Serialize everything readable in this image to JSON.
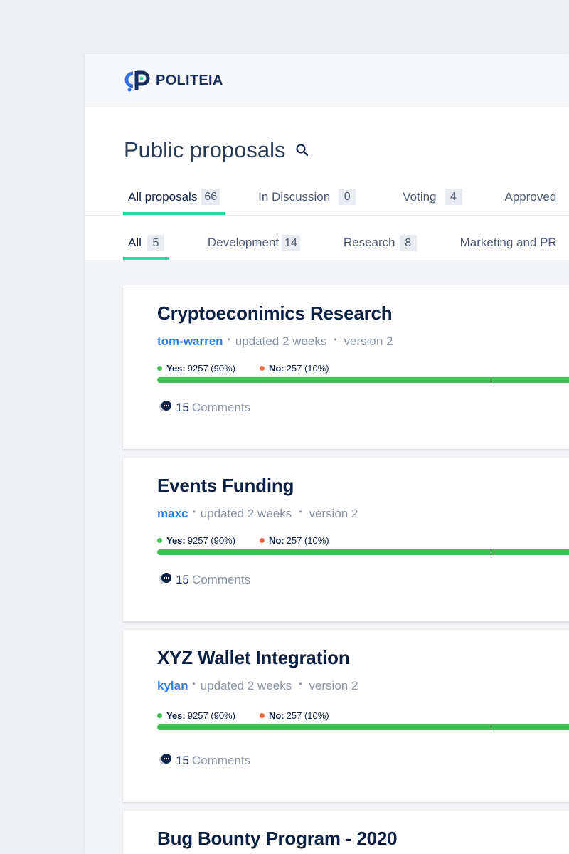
{
  "app": {
    "logo_text": "POLITEIA"
  },
  "page": {
    "title": "Public proposals"
  },
  "tabs": [
    {
      "label": "All proposals",
      "count": "66"
    },
    {
      "label": "In Discussion",
      "count": "0"
    },
    {
      "label": "Voting",
      "count": "4"
    },
    {
      "label": "Approved",
      "count": ""
    }
  ],
  "subtabs": [
    {
      "label": "All",
      "count": "5"
    },
    {
      "label": "Development",
      "count": "14"
    },
    {
      "label": "Research",
      "count": "8"
    },
    {
      "label": "Marketing and PR",
      "count": ""
    }
  ],
  "proposals": [
    {
      "title": "Cryptoeconimics Research",
      "author": "tom-warren",
      "updated": "updated 2 weeks",
      "version": "version 2",
      "yes_label": "Yes:",
      "yes_value": "9257 (90%)",
      "no_label": "No:",
      "no_value": "257 (10%)",
      "comments_count": "15",
      "comments_label": "Comments"
    },
    {
      "title": "Events Funding",
      "author": "maxc",
      "updated": "updated 2 weeks",
      "version": "version 2",
      "yes_label": "Yes:",
      "yes_value": "9257 (90%)",
      "no_label": "No:",
      "no_value": "257 (10%)",
      "comments_count": "15",
      "comments_label": "Comments"
    },
    {
      "title": "XYZ Wallet Integration",
      "author": "kylan",
      "updated": "updated 2 weeks",
      "version": "version 2",
      "yes_label": "Yes:",
      "yes_value": "9257 (90%)",
      "no_label": "No:",
      "no_value": "257 (10%)",
      "comments_count": "15",
      "comments_label": "Comments"
    },
    {
      "title": "Bug Bounty Program - 2020",
      "author": "",
      "updated": "",
      "version": "",
      "yes_label": "",
      "yes_value": "",
      "no_label": "",
      "no_value": "",
      "comments_count": "",
      "comments_label": ""
    }
  ],
  "colors": {
    "accent": "#2ed8a3",
    "yes": "#41bf53",
    "no": "#ed6d47",
    "link": "#2f7ee7",
    "title": "#0a1f44"
  }
}
